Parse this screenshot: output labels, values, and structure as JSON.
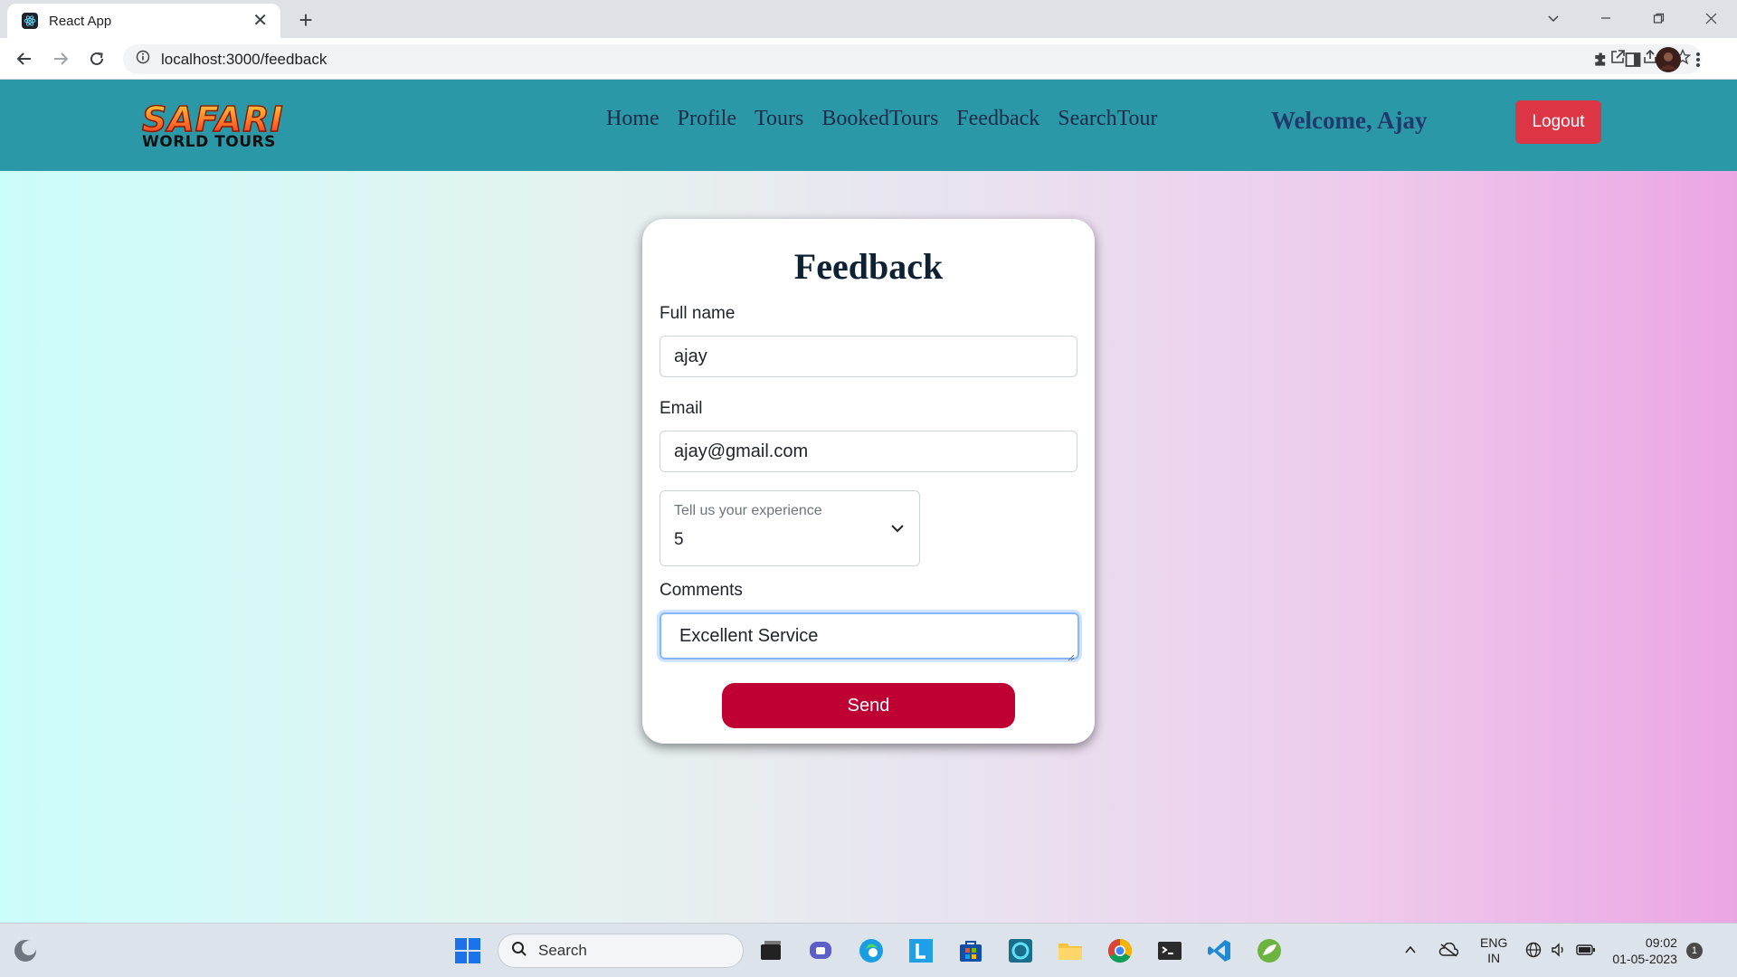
{
  "browser": {
    "tab_title": "React App",
    "url": "localhost:3000/feedback"
  },
  "navbar": {
    "logo_top": "SAFARI",
    "logo_bottom": "WORLD TOURS",
    "links": [
      "Home",
      "Profile",
      "Tours",
      "BookedTours",
      "Feedback",
      "SearchTour"
    ],
    "welcome": "Welcome, Ajay",
    "logout_label": "Logout"
  },
  "form": {
    "title": "Feedback",
    "fullname_label": "Full name",
    "fullname_value": "ajay",
    "email_label": "Email",
    "email_value": "ajay@gmail.com",
    "experience_label": "Tell us your experience",
    "experience_value": "5",
    "comments_label": "Comments",
    "comments_value": "Excellent Service",
    "send_label": "Send"
  },
  "taskbar": {
    "search_placeholder": "Search",
    "lang_top": "ENG",
    "lang_bottom": "IN",
    "time": "09:02",
    "date": "01-05-2023",
    "notification_count": "1"
  },
  "colors": {
    "navbar": "#2a98a6",
    "logout": "#dc3545",
    "send": "#bf0033"
  }
}
